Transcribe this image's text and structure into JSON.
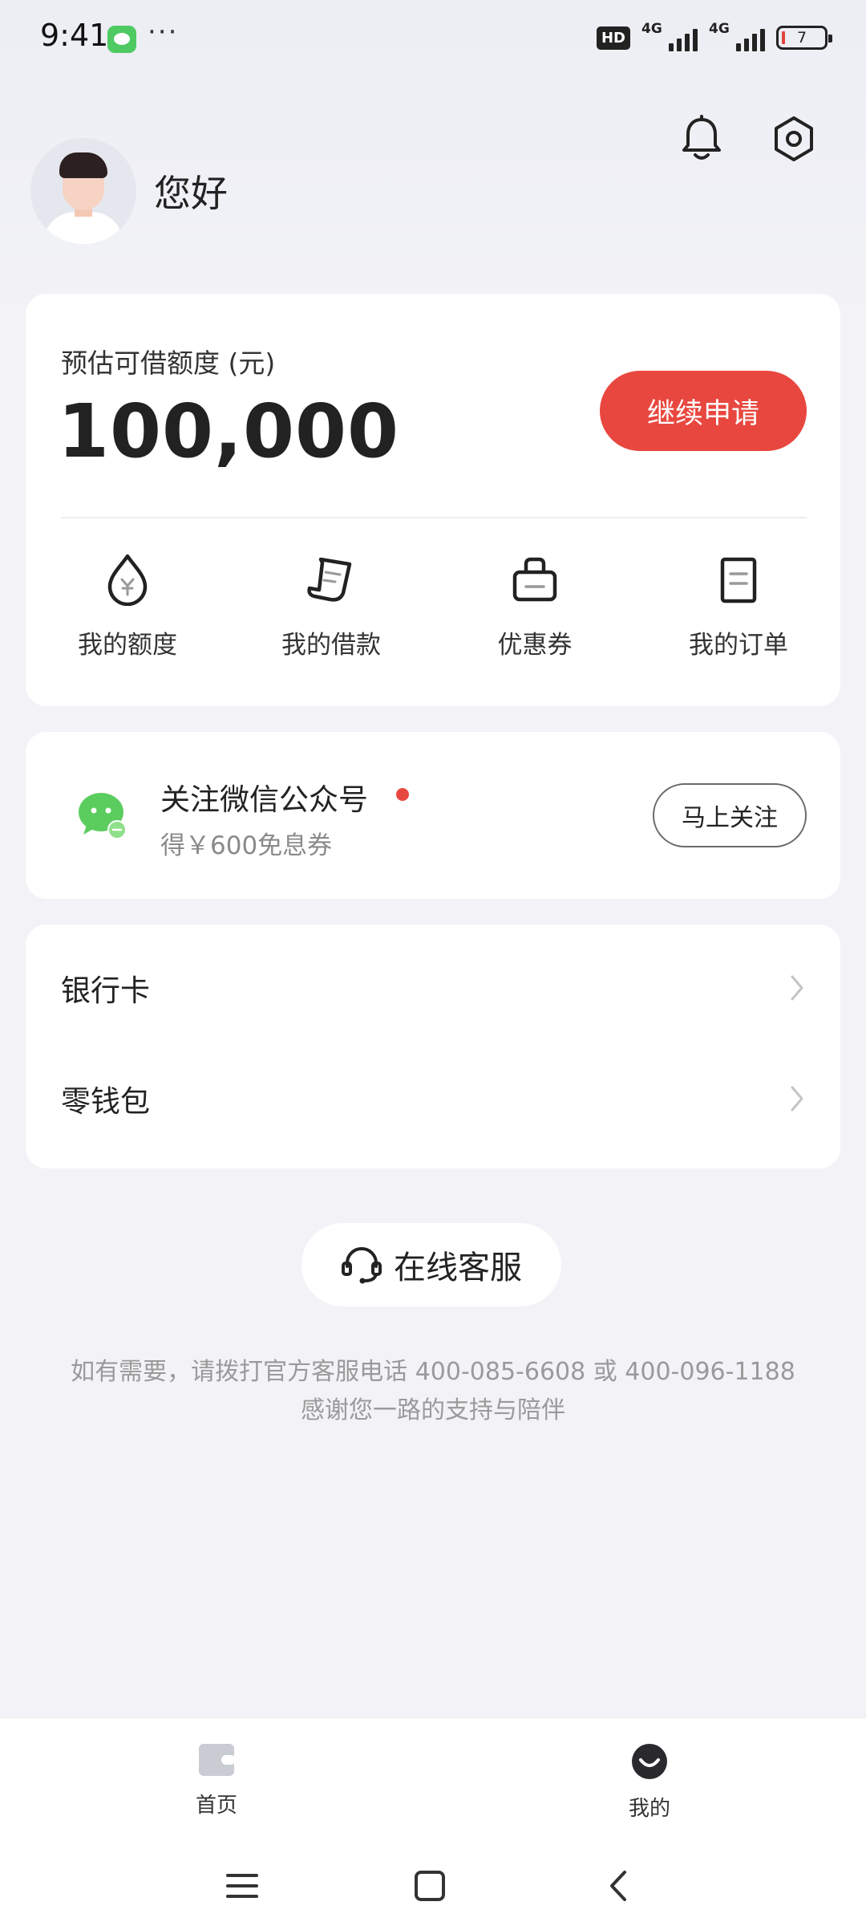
{
  "status_bar": {
    "time": "9:41",
    "dots": "···",
    "hd_label": "HD",
    "network_1": "4G",
    "network_2": "4G",
    "battery_level": "7"
  },
  "header": {
    "greeting": "您好",
    "icons": [
      "bell-icon",
      "settings-icon"
    ]
  },
  "credit_card": {
    "label": "预估可借额度 (元)",
    "amount": "100,000",
    "apply_button": "继续申请",
    "quick_actions": [
      {
        "label": "我的额度",
        "icon": "credit-drop-icon"
      },
      {
        "label": "我的借款",
        "icon": "loan-receipt-icon"
      },
      {
        "label": "优惠券",
        "icon": "coupon-bag-icon"
      },
      {
        "label": "我的订单",
        "icon": "order-doc-icon"
      }
    ]
  },
  "wechat_card": {
    "title": "关注微信公众号",
    "subtitle": "得￥600免息券",
    "follow_button": "马上关注"
  },
  "menu": {
    "items": [
      {
        "label": "银行卡"
      },
      {
        "label": "零钱包"
      }
    ]
  },
  "service": {
    "button": "在线客服",
    "hint_line1": "如有需要，请拨打官方客服电话 400-085-6608 或 400-096-1188",
    "hint_line2": "感谢您一路的支持与陪伴"
  },
  "tabbar": {
    "tabs": [
      {
        "label": "首页",
        "icon": "wallet-icon"
      },
      {
        "label": "我的",
        "icon": "smile-icon"
      }
    ]
  },
  "colors": {
    "accent": "#e8473f",
    "background": "#f3f3f7",
    "card": "#ffffff",
    "wechat_green": "#4fca63"
  }
}
